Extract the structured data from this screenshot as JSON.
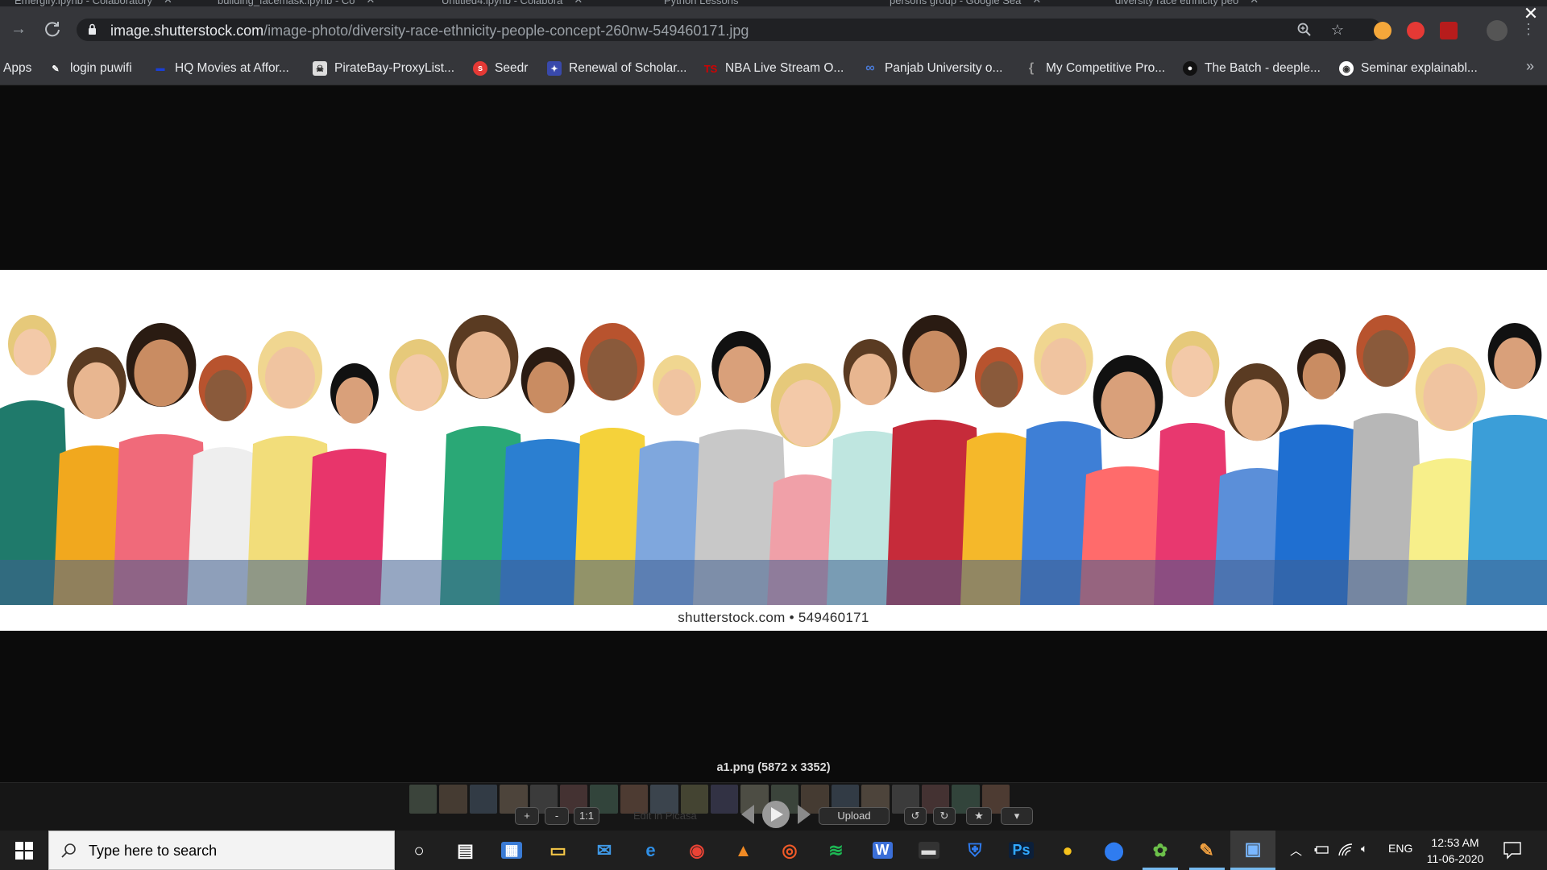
{
  "browser": {
    "tabs": [
      {
        "label": "Emergify.ipynb - Colaboratory"
      },
      {
        "label": "building_facemask.ipynb - Co"
      },
      {
        "label": "Untitled4.ipynb - Colabora"
      },
      {
        "label": "Python Lessons"
      },
      {
        "label": "persons group - Google Sea"
      },
      {
        "label": "diversity race ethnicity peo"
      }
    ],
    "url_host": "image.shutterstock.com",
    "url_path": "/image-photo/diversity-race-ethnicity-people-concept-260nw-549460171.jpg",
    "icons": [
      "back-icon",
      "reload-icon",
      "lock-icon",
      "zoom-icon",
      "star-icon",
      "menu-icon"
    ]
  },
  "bookmarks": [
    {
      "label": "Apps",
      "icon": "apps-icon",
      "color": "#4285f4"
    },
    {
      "label": "login puwifi",
      "icon": "pen-icon",
      "color": "#ffffff"
    },
    {
      "label": "HQ Movies at Affor...",
      "icon": "movies-icon",
      "color": "#1a3fd6"
    },
    {
      "label": "PirateBay-ProxyList...",
      "icon": "pirate-icon",
      "color": "#dddddd"
    },
    {
      "label": "Seedr",
      "icon": "seedr-icon",
      "color": "#e53935"
    },
    {
      "label": "Renewal of Scholar...",
      "icon": "scholar-icon",
      "color": "#c62828"
    },
    {
      "label": "NBA Live Stream O...",
      "icon": "ts-icon",
      "color": "#d50000"
    },
    {
      "label": "Panjab University o...",
      "icon": "infinity-icon",
      "color": "#4a7bd8"
    },
    {
      "label": "My Competitive Pro...",
      "icon": "bracket-icon",
      "color": "#777777"
    },
    {
      "label": "The Batch - deeple...",
      "icon": "batch-icon",
      "color": "#333333"
    },
    {
      "label": "Seminar explainabl...",
      "icon": "chrome-icon",
      "color": "#ffffff"
    }
  ],
  "viewer": {
    "watermark": "shutterstock.com • 549460171",
    "filename": "a1.png (5872 x 3352)"
  },
  "picasa": {
    "zoom_in": "+",
    "zoom_out": "-",
    "actual_size": "1:1",
    "edit": "Edit in Picasa",
    "upload": "Upload"
  },
  "taskbar": {
    "search_placeholder": "Type here to search",
    "apps": [
      "cortana-icon",
      "task-view-icon",
      "store-icon",
      "file-explorer-icon",
      "mail-icon",
      "edge-icon",
      "chrome-icon",
      "vlc-icon",
      "music-icon",
      "spotify-icon",
      "wps-icon",
      "terminal-icon",
      "shield-icon",
      "photoshop-icon",
      "emoji-icon",
      "maps-icon",
      "picasa-icon",
      "paint-icon",
      "photo-viewer-icon"
    ],
    "language": "ENG",
    "time": "12:53 AM",
    "date": "11-06-2020",
    "accent": "#76b9ed"
  }
}
